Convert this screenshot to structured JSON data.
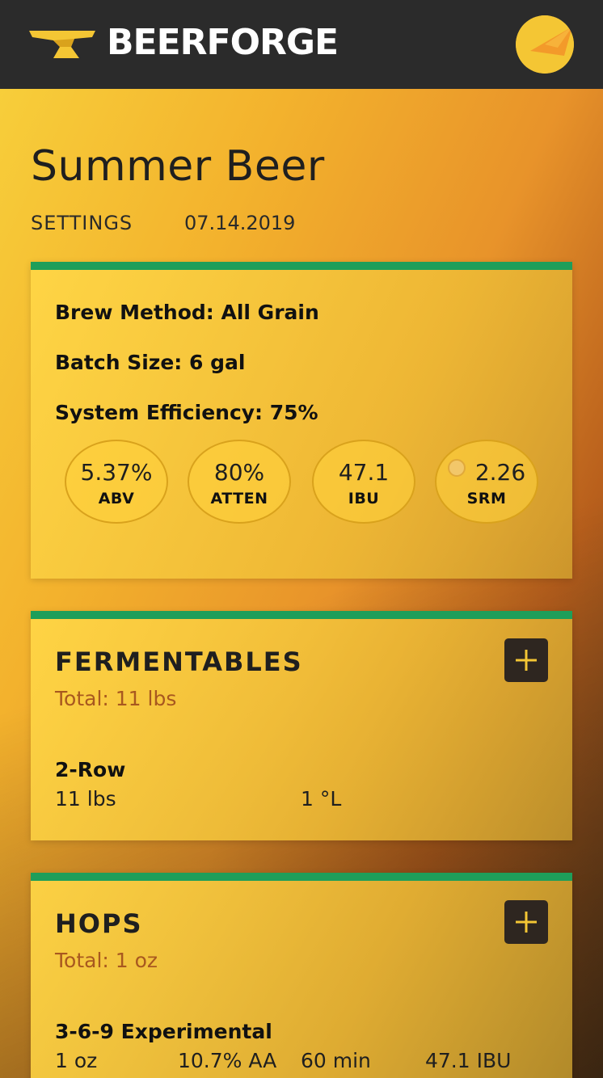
{
  "header": {
    "brand": "BEERFORGE",
    "logo_icon": "anvil-logo-icon",
    "avatar_icon": "user-avatar-icon"
  },
  "colors": {
    "header_bg": "#2b2b2b",
    "accent_green": "#1e9e5a",
    "total_text": "#a8581f",
    "add_button_bg": "#2e2620",
    "add_icon": "#f4c634"
  },
  "recipe": {
    "title": "Summer Beer",
    "settings_label": "SETTINGS",
    "date": "07.14.2019"
  },
  "settings": {
    "brew_method": "Brew Method: All Grain",
    "batch_size": "Batch Size: 6 gal",
    "efficiency": "System Efficiency: 75%",
    "stats": [
      {
        "value": "5.37%",
        "label": "ABV"
      },
      {
        "value": "80%",
        "label": "ATTEN"
      },
      {
        "value": "47.1",
        "label": "IBU"
      },
      {
        "value": "2.26",
        "label": "SRM"
      }
    ]
  },
  "fermentables": {
    "title": "FERMENTABLES",
    "total": "Total: 11 lbs",
    "add_icon": "plus-icon",
    "items": [
      {
        "name": "2-Row",
        "amount": "11 lbs",
        "color": "1 °L"
      }
    ]
  },
  "hops": {
    "title": "HOPS",
    "total": "Total: 1 oz",
    "add_icon": "plus-icon",
    "items": [
      {
        "name": "3-6-9 Experimental",
        "amount": "1 oz",
        "alpha": "10.7% AA",
        "time": "60 min",
        "ibu": "47.1 IBU"
      }
    ]
  }
}
